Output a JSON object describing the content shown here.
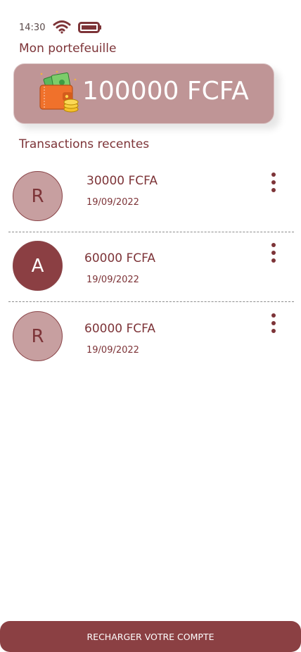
{
  "status_bar": {
    "time": "14:30"
  },
  "wallet": {
    "section_label": "Mon portefeuille",
    "balance": "100000 FCFA",
    "icon": "wallet-icon"
  },
  "transactions": {
    "section_label": "Transactions recentes",
    "items": [
      {
        "initial": "R",
        "amount": "30000 FCFA",
        "date": "19/09/2022"
      },
      {
        "initial": "A",
        "amount": "60000 FCFA",
        "date": "19/09/2022"
      },
      {
        "initial": "R",
        "amount": "60000 FCFA",
        "date": "19/09/2022"
      }
    ]
  },
  "actions": {
    "recharge_label": "RECHARGER VOTRE COMPTE"
  },
  "colors": {
    "accent": "#8b4043",
    "card": "#bf9596",
    "avatar_light": "#c79fa0",
    "avatar_dark": "#8b3f43",
    "text": "#7d3438"
  }
}
